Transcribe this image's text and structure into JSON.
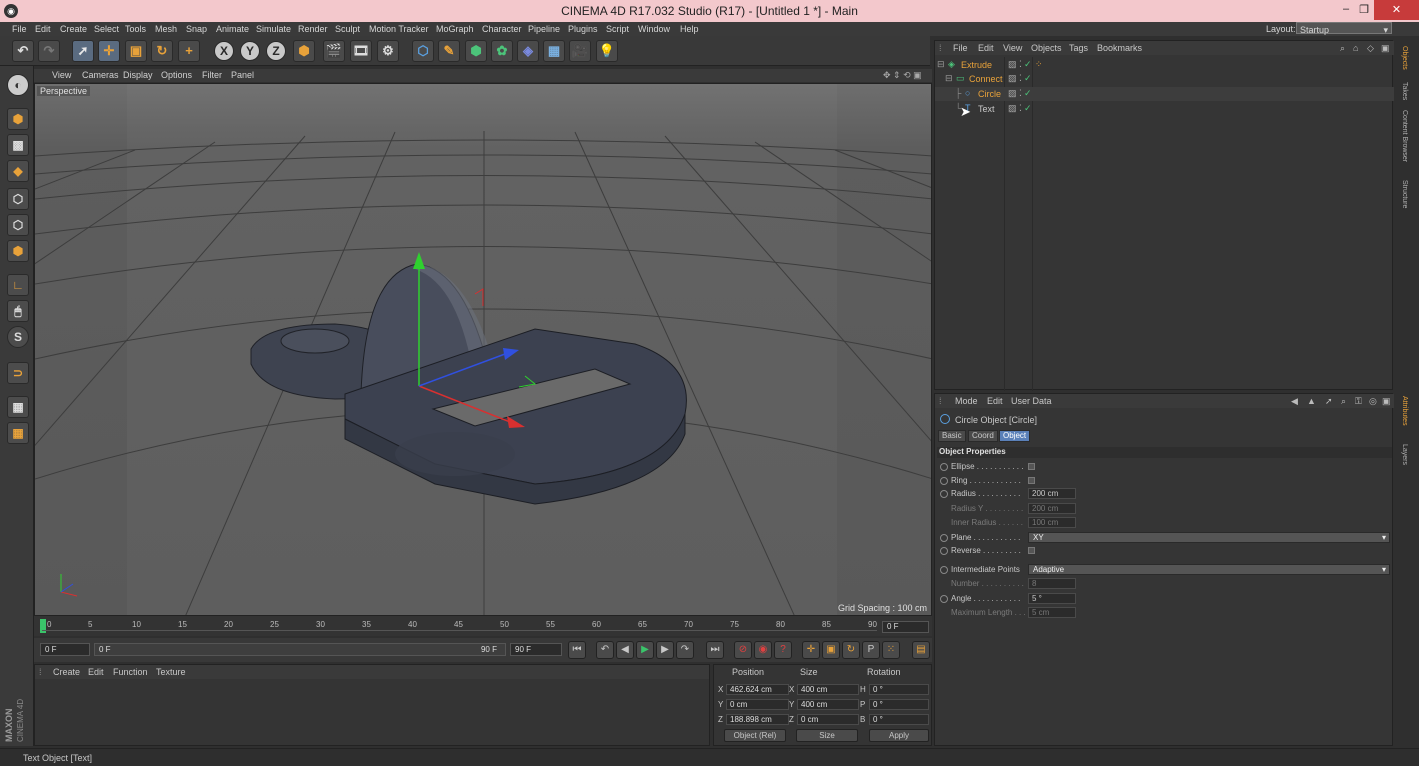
{
  "app": {
    "title": "CINEMA 4D R17.032 Studio (R17) - [Untitled 1 *] - Main"
  },
  "menu": [
    "File",
    "Edit",
    "Create",
    "Select",
    "Tools",
    "Mesh",
    "Snap",
    "Animate",
    "Simulate",
    "Render",
    "Sculpt",
    "Motion Tracker",
    "MoGraph",
    "Character",
    "Pipeline",
    "Plugins",
    "Script",
    "Window",
    "Help"
  ],
  "layout": {
    "label": "Layout:",
    "value": "Startup"
  },
  "viewport": {
    "menu": [
      "View",
      "Cameras",
      "Display",
      "Options",
      "Filter",
      "Panel"
    ],
    "label": "Perspective",
    "grid_spacing": "Grid Spacing : 100 cm"
  },
  "timeline": {
    "ticks": [
      "0",
      "5",
      "10",
      "15",
      "20",
      "25",
      "30",
      "35",
      "40",
      "45",
      "50",
      "55",
      "60",
      "65",
      "70",
      "75",
      "80",
      "85",
      "90"
    ],
    "current_frame": "0 F"
  },
  "transport": {
    "start": "0 F",
    "range_start": "0 F",
    "range_end": "90 F",
    "end": "90 F"
  },
  "material_manager": {
    "menu": [
      "Create",
      "Edit",
      "Function",
      "Texture"
    ]
  },
  "coordinates": {
    "headers": {
      "position": "Position",
      "size": "Size",
      "rotation": "Rotation"
    },
    "rows": [
      {
        "axis": "X",
        "pos": "462.624 cm",
        "saxis": "X",
        "size": "400 cm",
        "raxis": "H",
        "rot": "0 °"
      },
      {
        "axis": "Y",
        "pos": "0 cm",
        "saxis": "Y",
        "size": "400 cm",
        "raxis": "P",
        "rot": "0 °"
      },
      {
        "axis": "Z",
        "pos": "188.898 cm",
        "saxis": "Z",
        "size": "0 cm",
        "raxis": "B",
        "rot": "0 °"
      }
    ],
    "mode": "Object (Rel)",
    "size_mode": "Size",
    "apply": "Apply"
  },
  "object_manager": {
    "menu": [
      "File",
      "Edit",
      "View",
      "Objects",
      "Tags",
      "Bookmarks"
    ],
    "objects": [
      {
        "name": "Extrude",
        "color": "#e8a23a"
      },
      {
        "name": "Connect",
        "color": "#e8a23a"
      },
      {
        "name": "Circle",
        "color": "#e8a23a"
      },
      {
        "name": "Text",
        "color": "#c8c8c8"
      }
    ]
  },
  "attributes": {
    "menu": [
      "Mode",
      "Edit",
      "User Data"
    ],
    "object_title": "Circle Object [Circle]",
    "tabs": [
      "Basic",
      "Coord",
      "Object"
    ],
    "active_tab": "Object",
    "section": "Object Properties",
    "props": [
      {
        "label": "Ellipse . . . . . . . . . . .",
        "type": "check",
        "dim": false
      },
      {
        "label": "Ring . . . . . . . . . . . .",
        "type": "check",
        "dim": false
      },
      {
        "label": "Radius . . . . . . . . . .",
        "type": "value",
        "value": "200 cm",
        "dim": false
      },
      {
        "label": "Radius Y . . . . . . . . .",
        "type": "value",
        "value": "200 cm",
        "dim": true
      },
      {
        "label": "Inner Radius . . . . . .",
        "type": "value",
        "value": "100 cm",
        "dim": true
      },
      {
        "label": "Plane . . . . . . . . . . .",
        "type": "dropdown",
        "value": "XY",
        "dim": false
      },
      {
        "label": "Reverse . . . . . . . . .",
        "type": "check",
        "dim": false
      },
      {
        "label": "Intermediate Points",
        "type": "dropdown",
        "value": "Adaptive",
        "dim": false
      },
      {
        "label": "Number . . . . . . . . . .",
        "type": "value",
        "value": "8",
        "dim": true
      },
      {
        "label": "Angle . . . . . . . . . . .",
        "type": "value",
        "value": "5 °",
        "dim": false
      },
      {
        "label": "Maximum Length . . .",
        "type": "value",
        "value": "5 cm",
        "dim": true
      }
    ]
  },
  "right_tabs": [
    "Objects",
    "Takes",
    "Content Browser",
    "Structure",
    "Attributes",
    "Layers"
  ],
  "branding": {
    "line1": "MAXON",
    "line2": "CINEMA 4D"
  },
  "status": "Text Object [Text]",
  "icons": [
    "undo-icon",
    "redo-icon",
    "select-arrow-icon",
    "move-icon",
    "scale-icon",
    "rotate-icon",
    "add-icon",
    "x-axis-icon",
    "y-axis-icon",
    "z-axis-icon",
    "world-coord-icon",
    "render-view-icon",
    "render-icon",
    "render-settings-icon",
    "cube-icon",
    "pen-icon",
    "subdivision-icon",
    "cloner-icon",
    "deformer-icon",
    "floor-icon",
    "camera-icon",
    "light-icon"
  ]
}
